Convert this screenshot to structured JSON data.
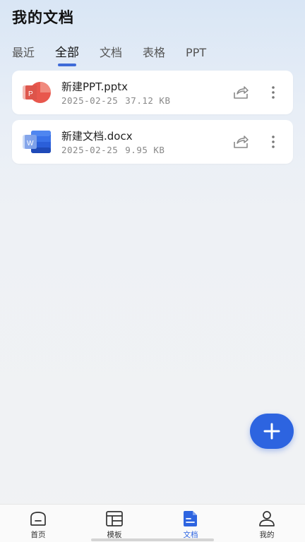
{
  "header": {
    "title": "我的文档"
  },
  "tabs": [
    {
      "label": "最近",
      "active": false
    },
    {
      "label": "全部",
      "active": true
    },
    {
      "label": "文档",
      "active": false
    },
    {
      "label": "表格",
      "active": false
    },
    {
      "label": "PPT",
      "active": false
    }
  ],
  "files": [
    {
      "name": "新建PPT.pptx",
      "date": "2025-02-25",
      "size": "37.12 KB",
      "type_icon": "powerpoint-icon",
      "icon_letter": "P"
    },
    {
      "name": "新建文档.docx",
      "date": "2025-02-25",
      "size": "9.95 KB",
      "type_icon": "word-icon",
      "icon_letter": "W"
    }
  ],
  "fab": {
    "icon": "plus-icon"
  },
  "bottom_nav": [
    {
      "label": "首页",
      "icon": "home-icon",
      "active": false
    },
    {
      "label": "模板",
      "icon": "template-icon",
      "active": false
    },
    {
      "label": "文档",
      "icon": "document-icon",
      "active": true
    },
    {
      "label": "我的",
      "icon": "user-icon",
      "active": false
    }
  ],
  "colors": {
    "accent": "#2d64e0",
    "tab_underline": "#3f6bd8",
    "powerpoint": "#d9453b",
    "word": "#2b5fd9"
  }
}
